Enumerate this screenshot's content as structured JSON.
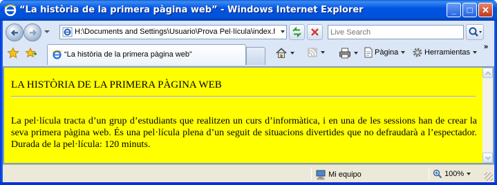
{
  "window": {
    "title": "“La història de la primera pàgina web” - Windows Internet Explorer",
    "minimize_glyph": "_",
    "maximize_glyph": "□",
    "close_glyph": "✕"
  },
  "navigation": {
    "address": "H:\\Documents and Settings\\Usuario\\Prova Pel·lícula\\index.htm",
    "search_placeholder": "Live Search"
  },
  "tabs": [
    {
      "label": "“La història de la primera pàgina web”"
    }
  ],
  "commandbar": {
    "page_label": "Pàgina",
    "tools_label": "Herramientas",
    "more": "»"
  },
  "content": {
    "heading": "LA HISTÒRIA DE LA PRIMERA PÀGINA WEB",
    "paragraph": "La pel·lícula tracta d’un grup d’estudiants que realitzen un curs d’informàtica, i en una de les sessions han de crear la seva primera pàgina web. És una pel·lícula plena d’un seguit de situacions divertides que no defraudarà a l’espectador. Durada de la pel·lícula: 120 minuts.",
    "background_color": "#ffff00"
  },
  "statusbar": {
    "zone": "Mi equipo",
    "zoom": "100%"
  },
  "icons": [
    "ie-icon",
    "back-arrow-icon",
    "forward-arrow-icon",
    "refresh-icon",
    "stop-icon",
    "search-icon",
    "favorites-star-icon",
    "add-favorites-icon",
    "home-icon",
    "feeds-icon",
    "print-icon",
    "page-icon",
    "tools-gear-icon",
    "computer-icon",
    "zoom-icon"
  ]
}
